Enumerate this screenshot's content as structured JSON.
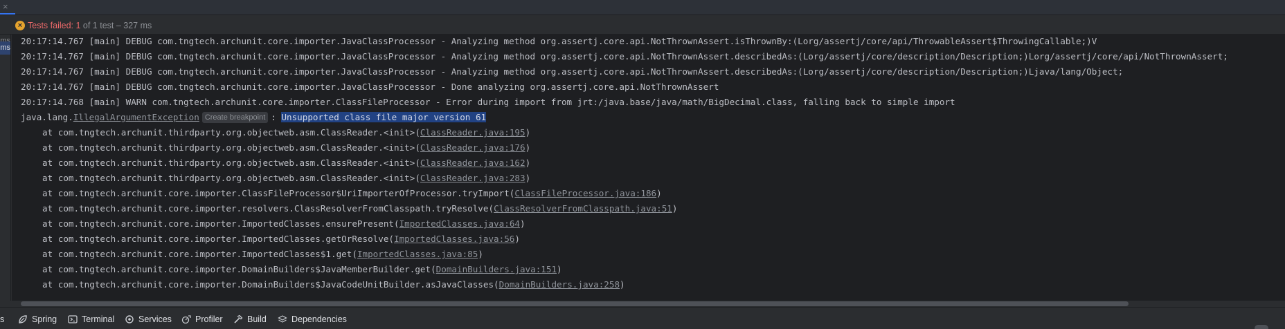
{
  "topbar": {
    "close_glyph": "×"
  },
  "status": {
    "icon": "warning-circle-icon",
    "failed_text": "Tests failed: 1",
    "rest_text": " of 1 test – 327 ms"
  },
  "gutter": {
    "items": [
      "ms",
      "ms"
    ]
  },
  "console": {
    "log_lines": [
      "20:17:14.767 [main] DEBUG com.tngtech.archunit.core.importer.JavaClassProcessor - Analyzing method org.assertj.core.api.NotThrownAssert.isThrownBy:(Lorg/assertj/core/api/ThrowableAssert$ThrowingCallable;)V",
      "20:17:14.767 [main] DEBUG com.tngtech.archunit.core.importer.JavaClassProcessor - Analyzing method org.assertj.core.api.NotThrownAssert.describedAs:(Lorg/assertj/core/description/Description;)Lorg/assertj/core/api/NotThrownAssert;",
      "20:17:14.767 [main] DEBUG com.tngtech.archunit.core.importer.JavaClassProcessor - Analyzing method org.assertj.core.api.NotThrownAssert.describedAs:(Lorg/assertj/core/description/Description;)Ljava/lang/Object;",
      "20:17:14.767 [main] DEBUG com.tngtech.archunit.core.importer.JavaClassProcessor - Done analyzing org.assertj.core.api.NotThrownAssert",
      "20:17:14.768 [main] WARN com.tngtech.archunit.core.importer.ClassFileProcessor - Error during import from jrt:/java.base/java/math/BigDecimal.class, falling back to simple import"
    ],
    "exception": {
      "package": "java.lang.",
      "class_link": "IllegalArgumentException",
      "hint": "Create breakpoint",
      "separator": ": ",
      "message": "Unsupported class file major version 61"
    },
    "stack": [
      {
        "prefix": "at com.tngtech.archunit.thirdparty.org.objectweb.asm.ClassReader.<init>(",
        "link": "ClassReader.java:195",
        "suffix": ")"
      },
      {
        "prefix": "at com.tngtech.archunit.thirdparty.org.objectweb.asm.ClassReader.<init>(",
        "link": "ClassReader.java:176",
        "suffix": ")"
      },
      {
        "prefix": "at com.tngtech.archunit.thirdparty.org.objectweb.asm.ClassReader.<init>(",
        "link": "ClassReader.java:162",
        "suffix": ")"
      },
      {
        "prefix": "at com.tngtech.archunit.thirdparty.org.objectweb.asm.ClassReader.<init>(",
        "link": "ClassReader.java:283",
        "suffix": ")"
      },
      {
        "prefix": "at com.tngtech.archunit.core.importer.ClassFileProcessor$UriImporterOfProcessor.tryImport(",
        "link": "ClassFileProcessor.java:186",
        "suffix": ")"
      },
      {
        "prefix": "at com.tngtech.archunit.core.importer.resolvers.ClassResolverFromClasspath.tryResolve(",
        "link": "ClassResolverFromClasspath.java:51",
        "suffix": ")"
      },
      {
        "prefix": "at com.tngtech.archunit.core.importer.ImportedClasses.ensurePresent(",
        "link": "ImportedClasses.java:64",
        "suffix": ")"
      },
      {
        "prefix": "at com.tngtech.archunit.core.importer.ImportedClasses.getOrResolve(",
        "link": "ImportedClasses.java:56",
        "suffix": ")"
      },
      {
        "prefix": "at com.tngtech.archunit.core.importer.ImportedClasses$1.get(",
        "link": "ImportedClasses.java:85",
        "suffix": ")"
      },
      {
        "prefix": "at com.tngtech.archunit.core.importer.DomainBuilders$JavaMemberBuilder.get(",
        "link": "DomainBuilders.java:151",
        "suffix": ")"
      },
      {
        "prefix": "at com.tngtech.archunit.core.importer.DomainBuilders$JavaCodeUnitBuilder.asJavaClasses(",
        "link": "DomainBuilders.java:258",
        "suffix": ")"
      }
    ]
  },
  "toolwindows": [
    {
      "label": "s",
      "icon": "partial-icon"
    },
    {
      "label": "Spring",
      "icon": "spring-leaf-icon"
    },
    {
      "label": "Terminal",
      "icon": "terminal-icon"
    },
    {
      "label": "Services",
      "icon": "services-gear-icon"
    },
    {
      "label": "Profiler",
      "icon": "profiler-icon"
    },
    {
      "label": "Build",
      "icon": "hammer-icon"
    },
    {
      "label": "Dependencies",
      "icon": "layers-icon"
    }
  ],
  "colors": {
    "console_bg": "#1e1f22",
    "panel_bg": "#2b2d30",
    "error_text": "#ee6a6a",
    "warning_icon": "#e5a32e",
    "selection": "#214283"
  }
}
